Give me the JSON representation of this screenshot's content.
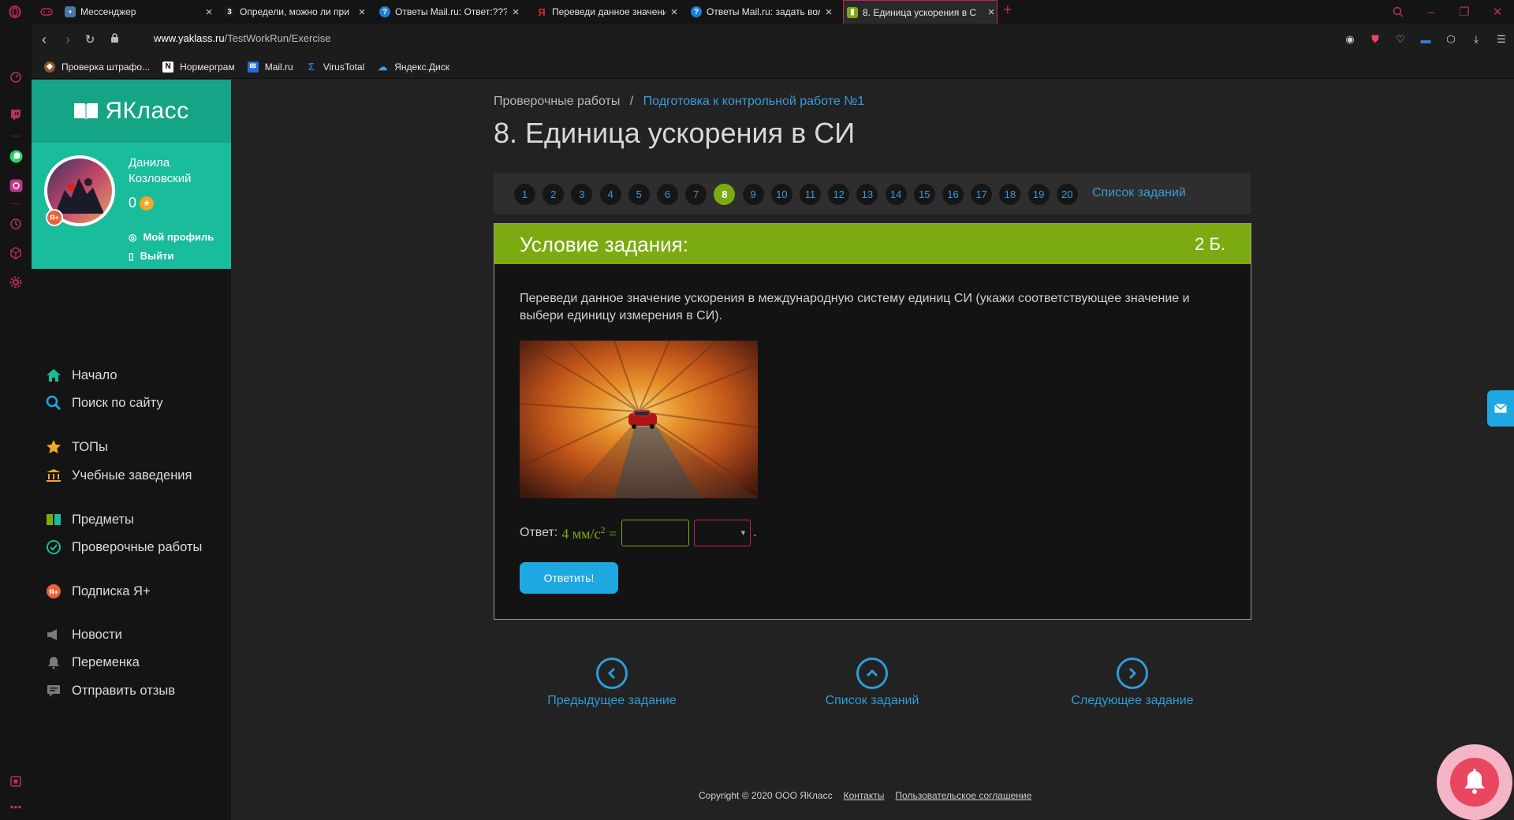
{
  "browser": {
    "tabs": [
      {
        "title": "Мессенджер",
        "favicon_color": "#4a76a8"
      },
      {
        "title": "Определи, можно ли при",
        "favicon_color": "#1a1a1a"
      },
      {
        "title": "Ответы Mail.ru: Ответ:???",
        "favicon_color": "#1e7fd8"
      },
      {
        "title": "Переведи данное значени",
        "favicon_color": "#e52620"
      },
      {
        "title": "Ответы Mail.ru: задать вол",
        "favicon_color": "#1e7fd8"
      },
      {
        "title": "8. Единица ускорения в С",
        "favicon_color": "#7cab11"
      }
    ],
    "url_host": "www.yaklass.ru",
    "url_path": "/TestWorkRun/Exercise",
    "bookmarks": [
      {
        "label": "Проверка штрафо...",
        "icon": "emblem-icon"
      },
      {
        "label": "Нормергрaм",
        "icon": "n-icon"
      },
      {
        "label": "Mail.ru",
        "icon": "mail-icon"
      },
      {
        "label": "VirusTotal",
        "icon": "virustotal-icon"
      },
      {
        "label": "Яндекс.Диск",
        "icon": "disk-icon"
      }
    ]
  },
  "sidebar": {
    "logo": "ЯКласс",
    "user_first": "Данила",
    "user_last": "Козловский",
    "points": "0",
    "profile_link": "Мой профиль",
    "logout_link": "Выйти",
    "menu": [
      {
        "label": "Начало",
        "icon": "home-icon"
      },
      {
        "label": "Поиск по сайту",
        "icon": "search-icon"
      },
      {
        "label": "ТОПы",
        "icon": "star-icon"
      },
      {
        "label": "Учебные заведения",
        "icon": "institution-icon"
      },
      {
        "label": "Предметы",
        "icon": "book-icon"
      },
      {
        "label": "Проверочные работы",
        "icon": "check-icon"
      },
      {
        "label": "Подписка Я+",
        "icon": "subscription-icon"
      },
      {
        "label": "Новости",
        "icon": "news-icon"
      },
      {
        "label": "Переменка",
        "icon": "bell-icon"
      },
      {
        "label": "Отправить отзыв",
        "icon": "feedback-icon"
      }
    ]
  },
  "breadcrumb": {
    "root": "Проверочные работы",
    "separator": "/",
    "current": "Подготовка к контрольной работе №1"
  },
  "page_title": "8. Единица ускорения в СИ",
  "question_nav": {
    "numbers": [
      "1",
      "2",
      "3",
      "4",
      "5",
      "6",
      "7",
      "8",
      "9",
      "10",
      "11",
      "12",
      "13",
      "14",
      "15",
      "16",
      "17",
      "18",
      "19",
      "20"
    ],
    "active": "8",
    "list_label": "Список заданий"
  },
  "task": {
    "header": "Условие задания:",
    "points": "2 Б.",
    "text": "Переведи данное значение ускорения в международную систему единиц СИ (укажи соответствующее значение и выбери единицу измерения в СИ).",
    "answer_label": "Ответ:",
    "formula_value": "4 мм/с",
    "formula_exp": "2",
    "formula_eq": "=",
    "answer_value": "",
    "unit_selected": "",
    "trailing": ".",
    "submit_label": "Ответить!"
  },
  "bottom_nav": {
    "prev": "Предыдущее задание",
    "list": "Список заданий",
    "next": "Следующее задание"
  },
  "footer": {
    "copyright": "Copyright © 2020 ООО ЯКласс",
    "contacts": "Контакты",
    "agreement": "Пользовательское соглашение"
  },
  "colors": {
    "accent_green": "#7cab11",
    "link_blue": "#3a9ad9",
    "teal": "#19bc9b",
    "opera_red": "#c0245a"
  }
}
